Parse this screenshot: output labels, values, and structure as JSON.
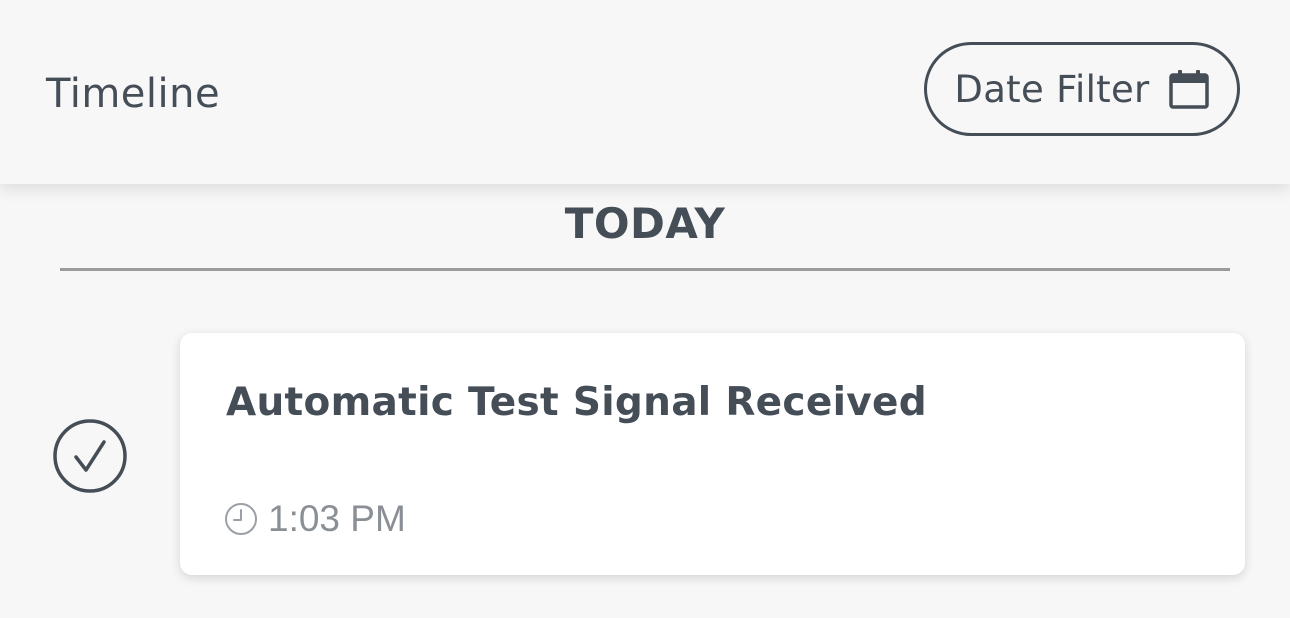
{
  "header": {
    "title": "Timeline",
    "date_filter_label": "Date Filter",
    "date_filter_icon": "calendar-icon"
  },
  "timeline": {
    "section_heading": "TODAY",
    "events": [
      {
        "title": "Automatic Test Signal Received",
        "time": "1:03 PM",
        "status_icon": "check-circle-icon",
        "time_icon": "clock-icon"
      }
    ]
  },
  "colors": {
    "background": "#f7f7f7",
    "text_primary": "#454d57",
    "text_secondary": "#8a8f96",
    "divider": "#9b9b9b",
    "card": "#ffffff"
  }
}
